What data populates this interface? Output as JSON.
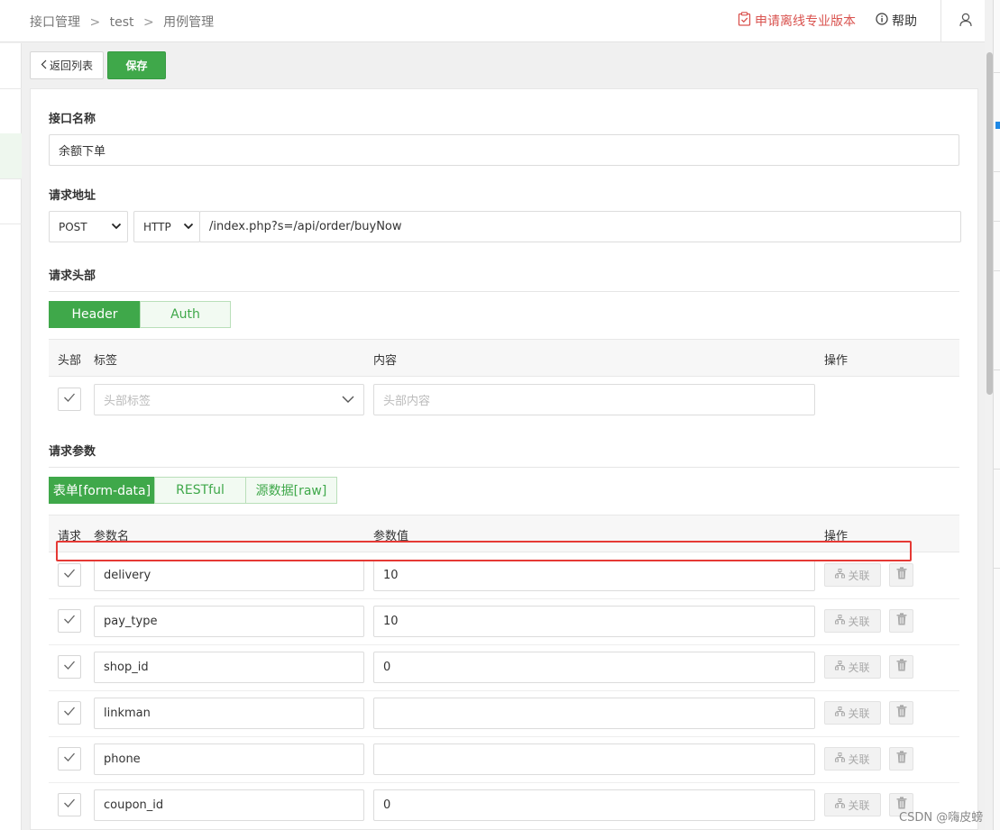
{
  "breadcrumb": [
    "接口管理",
    "test",
    "用例管理"
  ],
  "breadcrumb_sep": ">",
  "header": {
    "apply_pro": "申请离线专业版本",
    "help": "帮助"
  },
  "toolbar": {
    "back_label": "返回列表",
    "save_label": "保存"
  },
  "form": {
    "name_label": "接口名称",
    "name_value": "余额下单",
    "url_label": "请求地址",
    "method": "POST",
    "protocol": "HTTP",
    "url_value": "/index.php?s=/api/order/buyNow",
    "headers_label": "请求头部",
    "params_label": "请求参数"
  },
  "header_tabs": [
    "Header",
    "Auth"
  ],
  "header_table": {
    "columns": [
      "头部",
      "标签",
      "内容",
      "操作"
    ],
    "tag_placeholder": "头部标签",
    "content_placeholder": "头部内容"
  },
  "param_tabs": [
    "表单[form-data]",
    "RESTful",
    "源数据[raw]"
  ],
  "param_table": {
    "columns": [
      "请求",
      "参数名",
      "参数值",
      "操作"
    ],
    "link_label": "关联",
    "rows": [
      {
        "name": "delivery",
        "value": "10"
      },
      {
        "name": "pay_type",
        "value": "10"
      },
      {
        "name": "shop_id",
        "value": "0"
      },
      {
        "name": "linkman",
        "value": ""
      },
      {
        "name": "phone",
        "value": ""
      },
      {
        "name": "coupon_id",
        "value": "0"
      }
    ]
  },
  "watermark": "CSDN @嗨皮螃",
  "colors": {
    "accent": "#3fa84a",
    "danger": "#d9534f",
    "highlight_box": "#e53935"
  }
}
